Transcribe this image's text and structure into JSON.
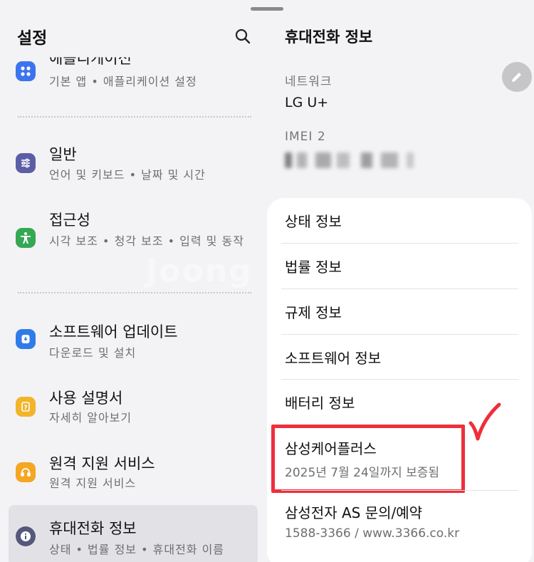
{
  "left": {
    "title": "설정",
    "items": [
      {
        "label": "애플리케이션",
        "sub": "기본 앱  •  애플리케이션 설정",
        "icon": "apps-icon",
        "color": "#3b74ee"
      },
      {
        "label": "일반",
        "sub": "언어 및 키보드  •  날짜 및 시간",
        "icon": "sliders-icon",
        "color": "#5b5ea6"
      },
      {
        "label": "접근성",
        "sub": "시각 보조  •  청각 보조  •  입력 및 동작",
        "icon": "accessibility-icon",
        "color": "#34a853"
      },
      {
        "label": "소프트웨어 업데이트",
        "sub": "다운로드 및 설치",
        "icon": "update-icon",
        "color": "#2f7ce9"
      },
      {
        "label": "사용 설명서",
        "sub": "자세히 알아보기",
        "icon": "manual-icon",
        "color": "#f2b429"
      },
      {
        "label": "원격 지원 서비스",
        "sub": "원격 지원 서비스",
        "icon": "headset-icon",
        "color": "#f5a623"
      },
      {
        "label": "휴대전화 정보",
        "sub": "상태  •  법률 정보  •  휴대전화 이름",
        "icon": "info-icon",
        "color": "#55587a"
      }
    ]
  },
  "right": {
    "title": "휴대전화 정보",
    "network_label": "네트워크",
    "network_value": "LG U+",
    "imei_label": "IMEI 2",
    "menu": [
      {
        "label": "상태 정보"
      },
      {
        "label": "법률 정보"
      },
      {
        "label": "규제 정보"
      },
      {
        "label": "소프트웨어 정보"
      },
      {
        "label": "배터리 정보"
      },
      {
        "label": "삼성케어플러스",
        "sub": "2025년 7월 24일까지 보증됨"
      },
      {
        "label": "삼성전자 AS 문의/예약",
        "sub": "1588-3366 / www.3366.co.kr"
      }
    ]
  },
  "colors": {
    "highlight": "#ee2f3c",
    "background": "#f3f3f5",
    "card": "#ffffff"
  },
  "watermark": "Joong"
}
